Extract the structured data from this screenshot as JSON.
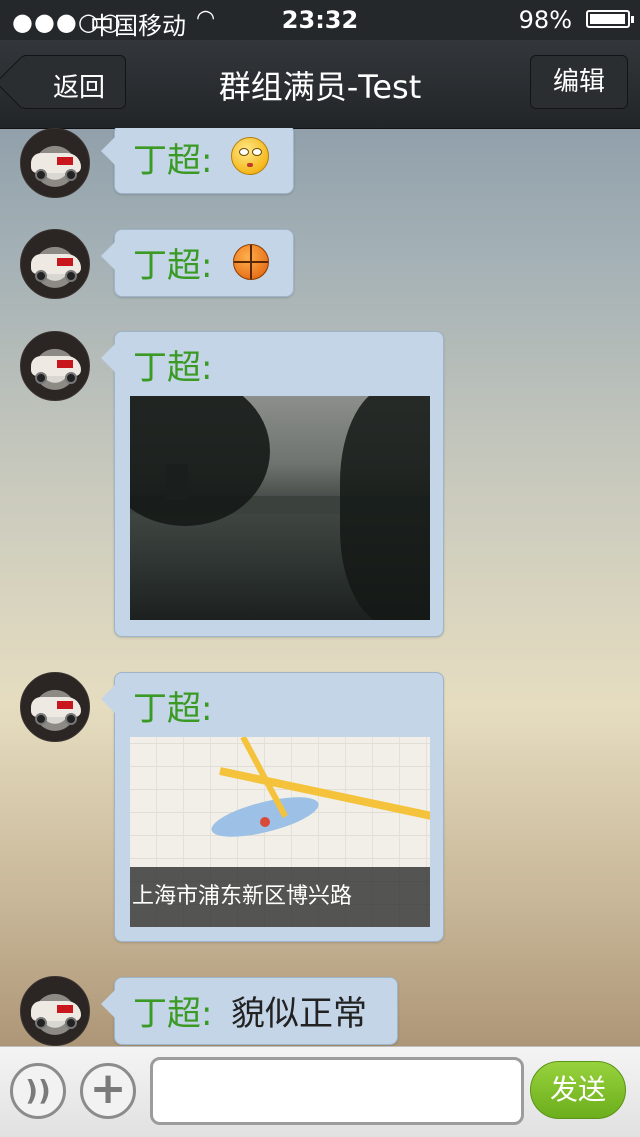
{
  "status_bar": {
    "signal": "●●●○○",
    "carrier": "中国移动",
    "wifi_icon": "wifi-icon",
    "time": "23:32",
    "battery_percent": "98%",
    "battery_level": 0.98
  },
  "nav": {
    "back_label": "返回",
    "title": "群组满员-Test",
    "edit_label": "编辑"
  },
  "messages": [
    {
      "sender": "丁超:",
      "type": "emoji",
      "emoji": "rolling-eyes-face-emoji"
    },
    {
      "sender": "丁超:",
      "type": "emoji",
      "emoji": "basketball-emoji"
    },
    {
      "sender": "丁超:",
      "type": "image",
      "image": "lake-photo"
    },
    {
      "sender": "丁超:",
      "type": "location",
      "address": "上海市浦东新区博兴路"
    },
    {
      "sender": "丁超:",
      "type": "text",
      "text": "貌似正常"
    }
  ],
  "input_bar": {
    "voice_icon": "voice-icon",
    "plus_icon": "plus-icon",
    "input_value": "",
    "send_label": "发送"
  }
}
